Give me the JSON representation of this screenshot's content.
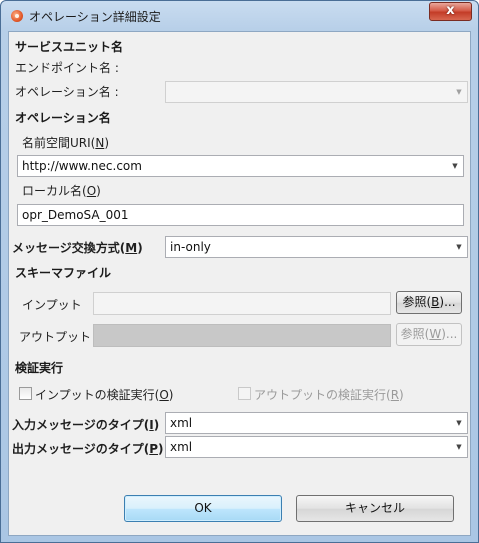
{
  "window": {
    "title": "オペレーション詳細設定",
    "close_label": "x"
  },
  "service_unit": {
    "header": "サービスユニット名",
    "endpoint_label": "エンドポイント名 :",
    "operation_label": "オペレーション名 :",
    "operation_value": ""
  },
  "operation": {
    "header": "オペレーション名",
    "namespace_label": "名前空間URI(",
    "namespace_mnemonic": "N",
    "namespace_value": "http://www.nec.com",
    "local_label": "ローカル名(",
    "local_mnemonic": "O",
    "local_value": "opr_DemoSA_001"
  },
  "message_exchange": {
    "label": "メッセージ交換方式(",
    "mnemonic": "M",
    "value": "in-only"
  },
  "schema": {
    "header": "スキーマファイル",
    "input_label": "インプット",
    "input_value": "",
    "input_browse": "参照(",
    "input_browse_mnemonic": "B",
    "output_label": "アウトプット",
    "output_value": "",
    "output_browse": "参照(",
    "output_browse_mnemonic": "W"
  },
  "validation": {
    "header": "検証実行",
    "input_check": "インプットの検証実行(",
    "input_check_mnemonic": "O",
    "output_check": "アウトプットの検証実行(",
    "output_check_mnemonic": "R",
    "input_type_label": "入力メッセージのタイプ(",
    "input_type_mnemonic": "I",
    "input_type_value": "xml",
    "output_type_label": "出力メッセージのタイプ(",
    "output_type_mnemonic": "P",
    "output_type_value": "xml"
  },
  "buttons": {
    "ok": "OK",
    "cancel": "キャンセル"
  },
  "icons": {
    "dropdown": "chevron-down-icon",
    "app": "app-icon",
    "close": "close-icon"
  },
  "colors": {
    "title_bar": "#b7cfe8",
    "close_button": "#c23a25",
    "ok_border": "#3c7fb1"
  }
}
